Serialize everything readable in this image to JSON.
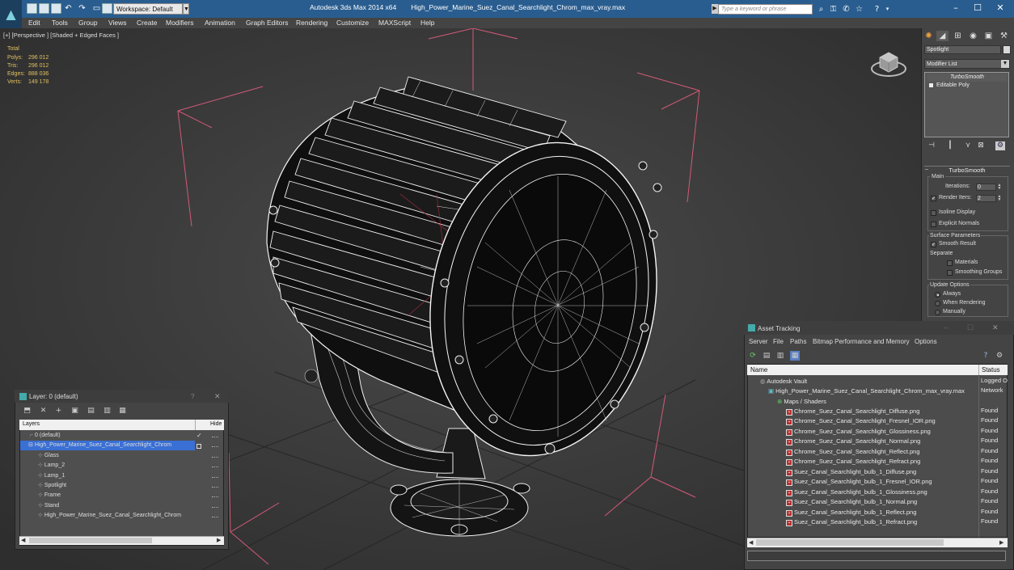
{
  "titlebar": {
    "app": "Autodesk 3ds Max  2014 x64",
    "file": "High_Power_Marine_Suez_Canal_Searchlight_Chrom_max_vray.max",
    "workspace": "Workspace: Default",
    "search_placeholder": "Type a keyword or phrase"
  },
  "menu": [
    "Edit",
    "Tools",
    "Group",
    "Views",
    "Create",
    "Modifiers",
    "Animation",
    "Graph Editors",
    "Rendering",
    "Customize",
    "MAXScript",
    "Help"
  ],
  "viewport": {
    "label": "[+] [Perspective ] [Shaded + Edged Faces ]",
    "stats": {
      "header": "Total",
      "rows": [
        {
          "label": "Polys:",
          "value": "296 012"
        },
        {
          "label": "Tris:",
          "value": "296 012"
        },
        {
          "label": "Edges:",
          "value": "888 036"
        },
        {
          "label": "Verts:",
          "value": "149 178"
        }
      ]
    }
  },
  "command_panel": {
    "object_name": "Spotlight",
    "modifier_list": "Modifier List",
    "stack": [
      "TurboSmooth",
      "Editable Poly"
    ],
    "rollout": {
      "title": "TurboSmooth",
      "main": "Main",
      "iterations_label": "Iterations:",
      "iterations_value": "0",
      "render_iters_label": "Render Iters:",
      "render_iters_value": "2",
      "isoline": "Isoline Display",
      "explicit_normals": "Explicit Normals",
      "surface_params": "Surface Parameters",
      "smooth_result": "Smooth Result",
      "separate": "Separate",
      "materials": "Materials",
      "smoothing_groups": "Smoothing Groups",
      "update_options": "Update Options",
      "always": "Always",
      "when_rendering": "When Rendering",
      "manually": "Manually"
    }
  },
  "layer_dialog": {
    "title": "Layer: 0 (default)",
    "question": "?",
    "col_layers": "Layers",
    "col_hide": "Hide",
    "rows": [
      {
        "name": "0 (default)",
        "selected": false
      },
      {
        "name": "High_Power_Marine_Suez_Canal_Searchlight_Chrom",
        "selected": true
      },
      {
        "name": "Glass",
        "selected": false
      },
      {
        "name": "Lamp_2",
        "selected": false
      },
      {
        "name": "Lamp_1",
        "selected": false
      },
      {
        "name": "Spotlight",
        "selected": false
      },
      {
        "name": "Frame",
        "selected": false
      },
      {
        "name": "Stand",
        "selected": false
      },
      {
        "name": "High_Power_Marine_Suez_Canal_Searchlight_Chrom",
        "selected": false
      }
    ]
  },
  "asset_tracking": {
    "title": "Asset Tracking",
    "menu": [
      "Server",
      "File",
      "Paths",
      "Bitmap Performance and Memory",
      "Options"
    ],
    "col_name": "Name",
    "col_status": "Status",
    "rows": [
      {
        "name": "Autodesk Vault",
        "status": "Logged O"
      },
      {
        "name": "High_Power_Marine_Suez_Canal_Searchlight_Chrom_max_vray.max",
        "status": "Network"
      },
      {
        "name": "Maps / Shaders",
        "status": ""
      },
      {
        "name": "Chrome_Suez_Canal_Searchlight_Diffuse.png",
        "status": "Found"
      },
      {
        "name": "Chrome_Suez_Canal_Searchlight_Fresnel_IOR.png",
        "status": "Found"
      },
      {
        "name": "Chrome_Suez_Canal_Searchlight_Glossiness.png",
        "status": "Found"
      },
      {
        "name": "Chrome_Suez_Canal_Searchlight_Normal.png",
        "status": "Found"
      },
      {
        "name": "Chrome_Suez_Canal_Searchlight_Reflect.png",
        "status": "Found"
      },
      {
        "name": "Chrome_Suez_Canal_Searchlight_Refract.png",
        "status": "Found"
      },
      {
        "name": "Suez_Canal_Searchlight_bulb_1_Diffuse.png",
        "status": "Found"
      },
      {
        "name": "Suez_Canal_Searchlight_bulb_1_Fresnel_IOR.png",
        "status": "Found"
      },
      {
        "name": "Suez_Canal_Searchlight_bulb_1_Glossiness.png",
        "status": "Found"
      },
      {
        "name": "Suez_Canal_Searchlight_bulb_1_Normal.png",
        "status": "Found"
      },
      {
        "name": "Suez_Canal_Searchlight_bulb_1_Reflect.png",
        "status": "Found"
      },
      {
        "name": "Suez_Canal_Searchlight_bulb_1_Refract.png",
        "status": "Found"
      }
    ]
  },
  "colors": {
    "titlebar": "#2a5d8f",
    "selection": "#3a6fd4",
    "stats": "#e0c060",
    "bounding_box": "#e06080"
  }
}
